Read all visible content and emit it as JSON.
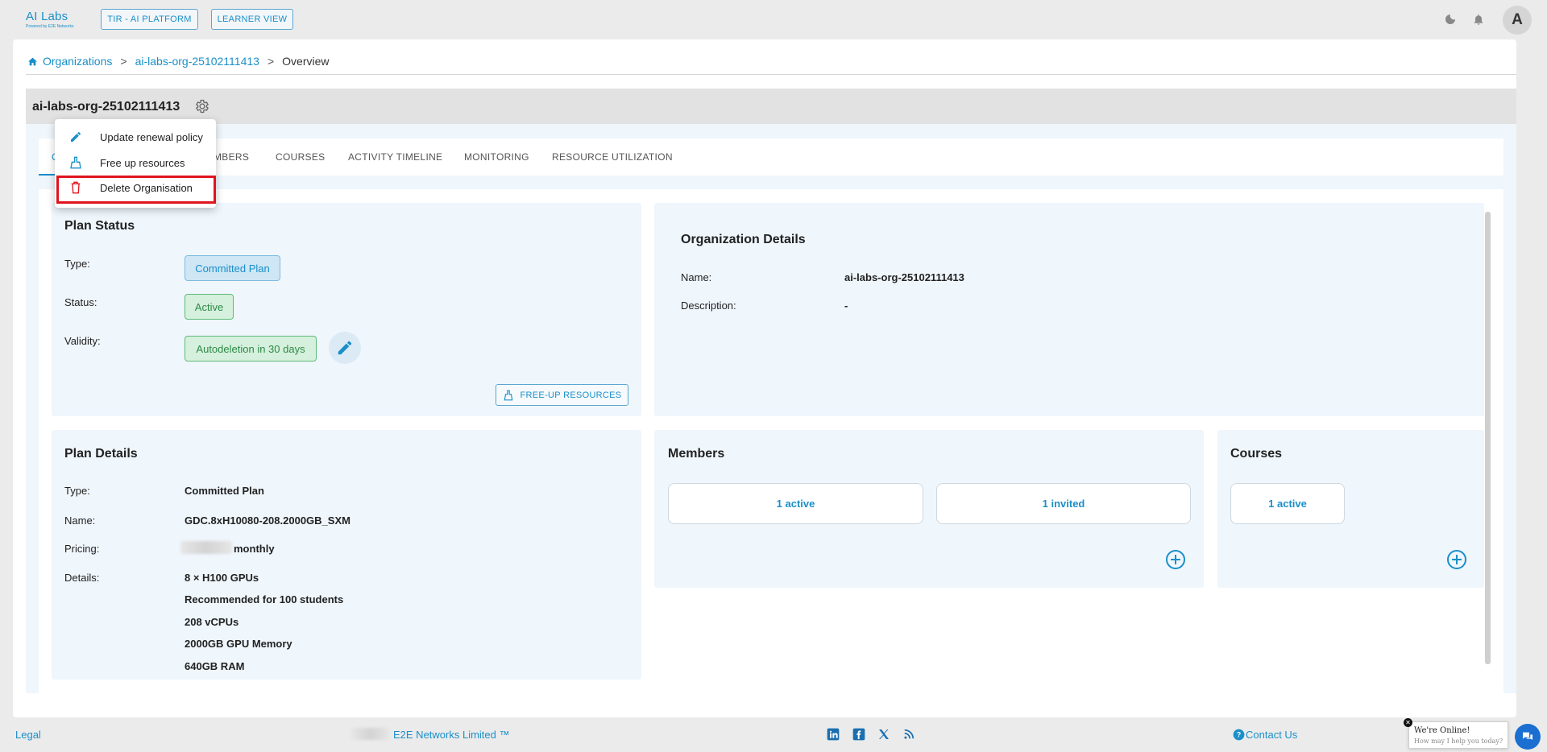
{
  "app": {
    "logo_text": "AI Labs",
    "logo_sub": "Powered by E2E Networks"
  },
  "header": {
    "platform_button": "TIR - AI PLATFORM",
    "learner_button": "LEARNER VIEW",
    "avatar_initial": "A"
  },
  "breadcrumb": {
    "root": "Organizations",
    "org": "ai-labs-org-25102111413",
    "current": "Overview",
    "separator": ">"
  },
  "org": {
    "title": "ai-labs-org-25102111413"
  },
  "tabs": [
    {
      "label": "OVERVIEW"
    },
    {
      "label": "MEMBERS"
    },
    {
      "label": "COURSES"
    },
    {
      "label": "ACTIVITY TIMELINE"
    },
    {
      "label": "MONITORING"
    },
    {
      "label": "RESOURCE UTILIZATION"
    }
  ],
  "tab_visible": {
    "members_partial": "MBERS"
  },
  "menu": {
    "items": [
      {
        "label": "Update renewal policy",
        "icon": "pencil-icon"
      },
      {
        "label": "Free up resources",
        "icon": "broom-icon"
      },
      {
        "label": "Delete Organisation",
        "icon": "trash-icon"
      }
    ]
  },
  "plan_status": {
    "title": "Plan Status",
    "type_label": "Type:",
    "type_value": "Committed Plan",
    "status_label": "Status:",
    "status_value": "Active",
    "validity_label": "Validity:",
    "validity_value": "Autodeletion in 30 days",
    "free_up_button": "FREE-UP RESOURCES"
  },
  "org_details": {
    "title": "Organization Details",
    "name_label": "Name:",
    "name_value": "ai-labs-org-25102111413",
    "description_label": "Description:",
    "description_value": "-"
  },
  "plan_details": {
    "title": "Plan Details",
    "type_label": "Type:",
    "type_value": "Committed Plan",
    "name_label": "Name:",
    "name_value": "GDC.8xH10080-208.2000GB_SXM",
    "pricing_label": "Pricing:",
    "pricing_suffix": "monthly",
    "details_label": "Details:",
    "details": [
      "8 × H100 GPUs",
      "Recommended for 100 students",
      "208 vCPUs",
      "2000GB GPU Memory",
      "640GB RAM"
    ]
  },
  "members": {
    "title": "Members",
    "active": "1 active",
    "invited": "1 invited"
  },
  "courses": {
    "title": "Courses",
    "active": "1 active"
  },
  "footer": {
    "legal": "Legal",
    "company": "E2E Networks Limited ™",
    "contact": "Contact Us"
  },
  "chat": {
    "line1": "We're Online!",
    "line2": "How may I help you today?"
  },
  "colors": {
    "accent": "#1a8fc9",
    "highlight": "#e0141e",
    "success": "#2d8a47"
  }
}
